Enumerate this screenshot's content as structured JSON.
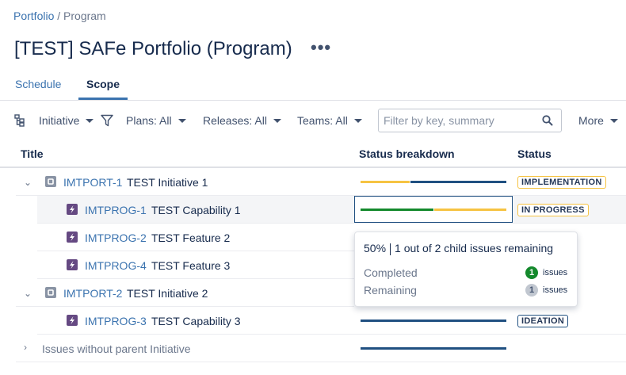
{
  "breadcrumb": {
    "root": "Portfolio",
    "separator": "/",
    "current": "Program"
  },
  "page": {
    "title": "[TEST] SAFe Portfolio (Program)",
    "more_label": "•••"
  },
  "tabs": [
    {
      "label": "Schedule"
    },
    {
      "label": "Scope"
    }
  ],
  "toolbar": {
    "hierarchy_label": "Initiative",
    "plans_label": "Plans: All",
    "releases_label": "Releases: All",
    "teams_label": "Teams: All",
    "search_placeholder": "Filter by key, summary",
    "more_label": "More"
  },
  "columns": {
    "title": "Title",
    "status_breakdown": "Status breakdown",
    "status": "Status"
  },
  "rows": [
    {
      "key": "IMTPORT-1",
      "summary": "TEST Initiative 1",
      "type": "initiative",
      "status": "IMPLEMENTATION",
      "breakdown": {
        "in_progress": 0.33,
        "todo": 0.67,
        "done": 0
      }
    },
    {
      "key": "IMTPROG-1",
      "summary": "TEST Capability 1",
      "type": "capability",
      "status": "IN PROGRESS",
      "breakdown": {
        "done": 0.5,
        "in_progress": 0.5,
        "todo": 0
      }
    },
    {
      "key": "IMTPROG-2",
      "summary": "TEST Feature 2",
      "type": "feature"
    },
    {
      "key": "IMTPROG-4",
      "summary": "TEST Feature 3",
      "type": "feature"
    },
    {
      "key": "IMTPORT-2",
      "summary": "TEST Initiative 2",
      "type": "initiative"
    },
    {
      "key": "IMTPROG-3",
      "summary": "TEST Capability 3",
      "type": "capability",
      "status": "IDEATION",
      "breakdown": {
        "todo": 1.0
      }
    },
    {
      "key": "",
      "summary": "Issues without parent Initiative",
      "type": "group",
      "breakdown": {
        "todo": 1.0
      }
    }
  ],
  "tooltip": {
    "percent": "50%",
    "summary": "1 out of 2 child issues remaining",
    "completed_label": "Completed",
    "completed_count": "1",
    "remaining_label": "Remaining",
    "remaining_count": "1",
    "unit": "issues"
  },
  "colors": {
    "done": "#14892c",
    "in_progress": "#f6c342",
    "todo": "#205081",
    "link": "#3b73af",
    "epic_purple": "#654982"
  }
}
